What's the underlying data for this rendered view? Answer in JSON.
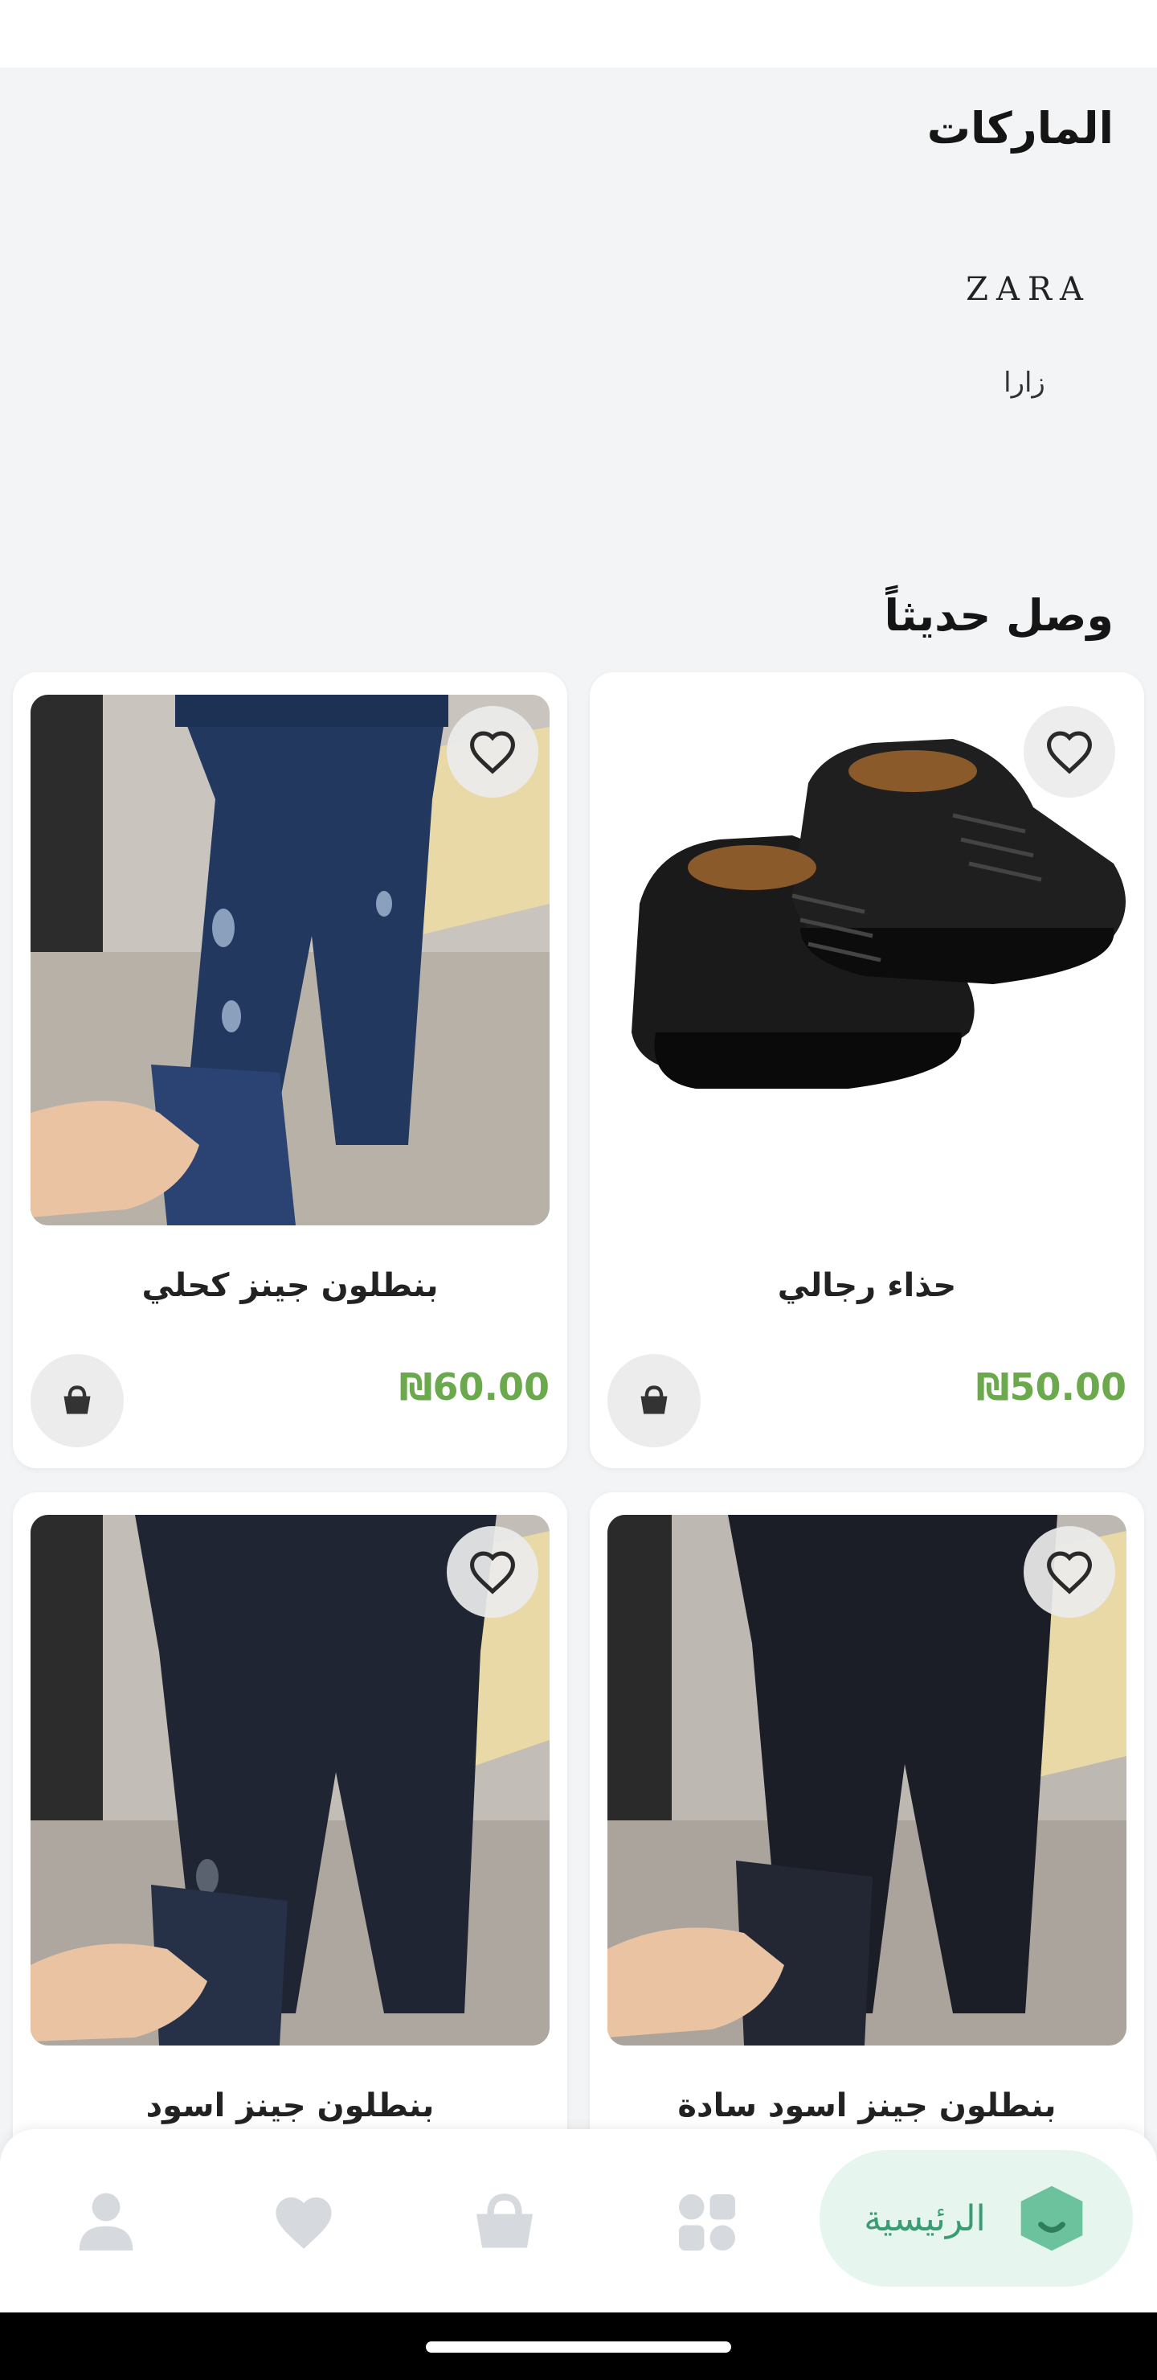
{
  "brands": {
    "title": "الماركات",
    "items": [
      {
        "logo_text": "ZARA",
        "name": "زارا"
      }
    ]
  },
  "new_arrivals": {
    "title": "وصل حديثاً",
    "products": [
      {
        "name": "حذاء رجالي",
        "price": "₪50.00",
        "image": "black-leather-shoes"
      },
      {
        "name": "بنطلون جينز كحلي",
        "price": "₪60.00",
        "image": "navy-ripped-jeans"
      },
      {
        "name": "بنطلون جينز اسود سادة",
        "price": "",
        "image": "plain-black-jeans"
      },
      {
        "name": "بنطلون جينز اسود",
        "price": "",
        "image": "black-jeans"
      }
    ]
  },
  "bottom_nav": {
    "home_label": "الرئيسية",
    "items": [
      "home",
      "categories",
      "cart",
      "favorites",
      "profile"
    ]
  },
  "colors": {
    "price": "#6aaa4c",
    "accent": "#3a9c72",
    "accent_bg": "#e6f5ee",
    "inactive_icon": "#d6d9de"
  }
}
